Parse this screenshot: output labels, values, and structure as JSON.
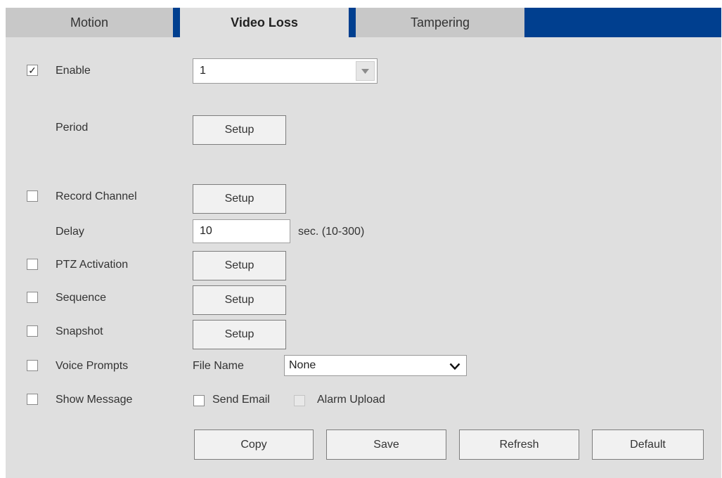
{
  "tabs": [
    {
      "label": "Motion",
      "active": false
    },
    {
      "label": "Video Loss",
      "active": true
    },
    {
      "label": "Tampering",
      "active": false
    }
  ],
  "enable": {
    "checked": true,
    "label": "Enable",
    "channel_value": "1"
  },
  "period": {
    "label": "Period",
    "button": "Setup"
  },
  "record_channel": {
    "checked": false,
    "label": "Record Channel",
    "button": "Setup"
  },
  "delay": {
    "label": "Delay",
    "value": "10",
    "unit": "sec. (10-300)"
  },
  "ptz_activation": {
    "checked": false,
    "label": "PTZ Activation",
    "button": "Setup"
  },
  "sequence": {
    "checked": false,
    "label": "Sequence",
    "button": "Setup"
  },
  "snapshot": {
    "checked": false,
    "label": "Snapshot",
    "button": "Setup"
  },
  "voice_prompts": {
    "checked": false,
    "label": "Voice Prompts",
    "file_name_label": "File Name",
    "file_value": "None"
  },
  "show_message": {
    "checked": false,
    "label": "Show Message"
  },
  "send_email": {
    "checked": false,
    "label": "Send Email"
  },
  "alarm_upload": {
    "checked": false,
    "disabled": true,
    "label": "Alarm Upload"
  },
  "actions": {
    "copy": "Copy",
    "save": "Save",
    "refresh": "Refresh",
    "default": "Default"
  },
  "check_mark": "✓",
  "colors": {
    "tab_bar": "#003f8f",
    "panel": "#dfdfdf",
    "tab_inactive": "#c8c8c8"
  }
}
